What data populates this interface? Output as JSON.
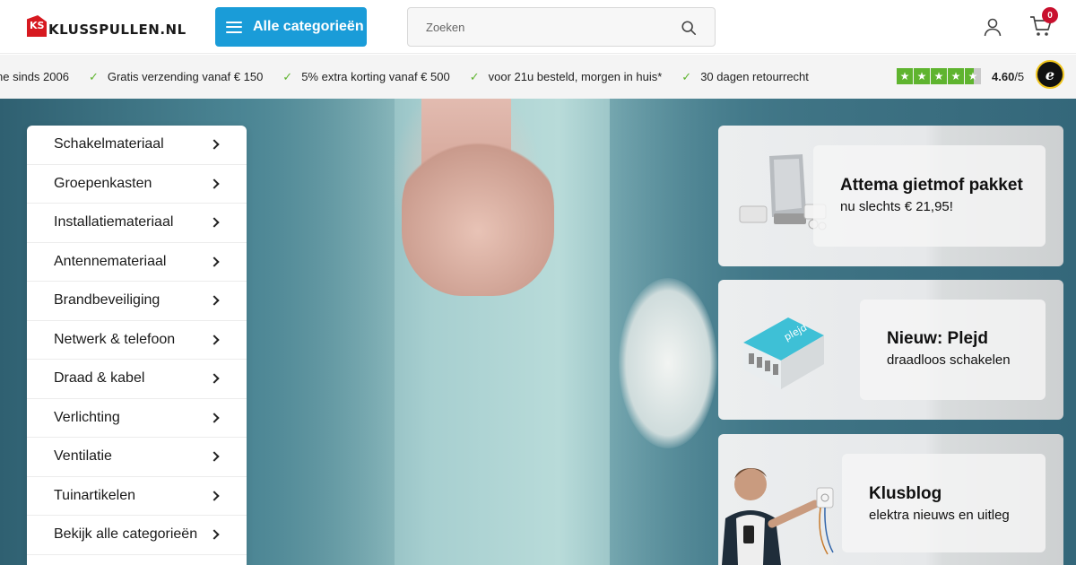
{
  "header": {
    "logo_text": "KLUSSPULLEN.NL",
    "logo_mark": "KS",
    "categories_button": "Alle categorieën",
    "search_placeholder": "Zoeken",
    "cart_count": "0",
    "icons": [
      "hamburger-icon",
      "search-icon",
      "account-icon",
      "cart-icon"
    ]
  },
  "usp_bar": {
    "items": [
      "ne sinds 2006",
      "Gratis verzending vanaf € 150",
      "5% extra korting vanaf € 500",
      "voor 21u besteld, morgen in huis*",
      "30 dagen retourrecht"
    ],
    "rating": "4.60",
    "rating_max": "/5",
    "rating_stars": 4.5,
    "trust_badge": "e",
    "accent_color": "#5fb42f"
  },
  "category_menu": {
    "items": [
      "Schakelmateriaal",
      "Groepenkasten",
      "Installatiemateriaal",
      "Antennemateriaal",
      "Brandbeveiliging",
      "Netwerk & telefoon",
      "Draad & kabel",
      "Verlichting",
      "Ventilatie",
      "Tuinartikelen",
      "Bekijk alle categorieën"
    ]
  },
  "promos": [
    {
      "title": "Attema gietmof pakket",
      "subtitle": "nu slechts € 21,95!"
    },
    {
      "title": "Nieuw: Plejd",
      "subtitle": "draadloos schakelen",
      "product_label": "plejd"
    },
    {
      "title": "Klusblog",
      "subtitle": "elektra nieuws en uitleg"
    }
  ],
  "colors": {
    "brand_blue": "#1a9cd8",
    "brand_red": "#d71920",
    "badge_red": "#c8102e"
  }
}
